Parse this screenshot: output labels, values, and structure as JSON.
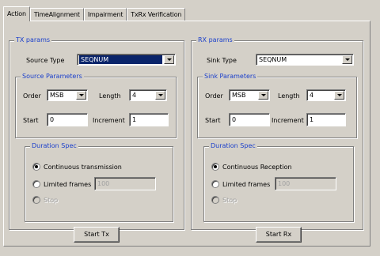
{
  "tabs": [
    {
      "label": "Action",
      "active": true
    },
    {
      "label": "TimeAlignment",
      "active": false
    },
    {
      "label": "Impairment",
      "active": false
    },
    {
      "label": "TxRx Verification",
      "active": false
    }
  ],
  "tx": {
    "title": "TX params",
    "type_label": "Source Type",
    "type_value": "SEQNUM",
    "params_title": "Source Parameters",
    "order_label": "Order",
    "order_value": "MSB",
    "length_label": "Length",
    "length_value": "4",
    "start_label": "Start",
    "start_value": "0",
    "increment_label": "Increment",
    "increment_value": "1",
    "duration_title": "Duration Spec",
    "continuous_label": "Continuous transmission",
    "limited_label": "Limited frames",
    "limited_value": "100",
    "third_label": "Stop",
    "selected_option": "continuous",
    "start_button": "Start Tx"
  },
  "rx": {
    "title": "RX params",
    "type_label": "Sink Type",
    "type_value": "SEQNUM",
    "params_title": "Sink Parameters",
    "order_label": "Order",
    "order_value": "MSB",
    "length_label": "Length",
    "length_value": "4",
    "start_label": "Start",
    "start_value": "0",
    "increment_label": "Increment",
    "increment_value": "1",
    "duration_title": "Duration Spec",
    "continuous_label": "Continuous Reception",
    "limited_label": "Limited frames",
    "limited_value": "100",
    "third_label": "Stop",
    "selected_option": "continuous",
    "start_button": "Start Rx"
  },
  "colors": {
    "background": "#d4d0c8",
    "legend_text": "#1a3fcc",
    "selection": "#0a246a"
  }
}
